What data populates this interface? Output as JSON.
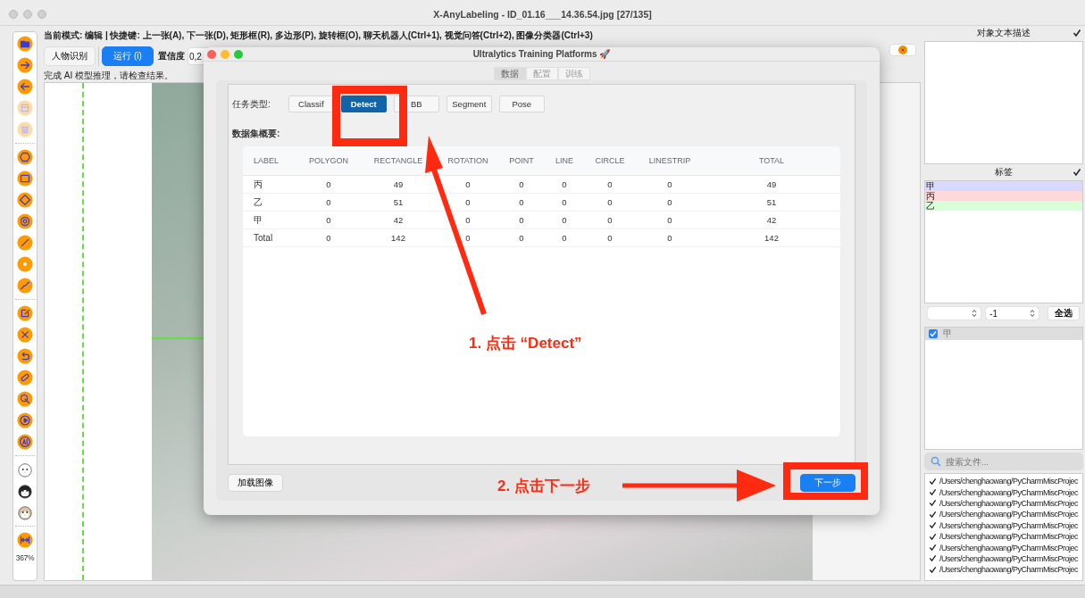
{
  "window": {
    "title": "X-AnyLabeling - ID_01.16___14.36.54.jpg [27/135]"
  },
  "tools": [
    {
      "kind": "folder",
      "disabled": false
    },
    {
      "kind": "next",
      "disabled": false
    },
    {
      "kind": "prev",
      "disabled": false
    },
    {
      "kind": "save",
      "disabled": true
    },
    {
      "kind": "trash",
      "disabled": true
    },
    {
      "kind": "separator"
    },
    {
      "kind": "hexagon",
      "disabled": false
    },
    {
      "kind": "rectangle",
      "disabled": false
    },
    {
      "kind": "diamond",
      "disabled": false
    },
    {
      "kind": "circle",
      "disabled": false
    },
    {
      "kind": "line",
      "disabled": false
    },
    {
      "kind": "point",
      "disabled": false
    },
    {
      "kind": "linestrip",
      "disabled": false
    },
    {
      "kind": "separator"
    },
    {
      "kind": "edit",
      "disabled": false
    },
    {
      "kind": "close",
      "disabled": false
    },
    {
      "kind": "undo",
      "disabled": false
    },
    {
      "kind": "link",
      "disabled": false
    },
    {
      "kind": "cursor",
      "disabled": false
    },
    {
      "kind": "play",
      "disabled": false
    },
    {
      "kind": "ai",
      "disabled": false
    },
    {
      "kind": "separator"
    },
    {
      "kind": "chick",
      "disabled": false
    },
    {
      "kind": "dog",
      "disabled": false
    },
    {
      "kind": "cat",
      "disabled": false
    },
    {
      "kind": "separator"
    },
    {
      "kind": "fit",
      "disabled": false
    }
  ],
  "zoom_level": "367%",
  "mode_line": "当前模式:  编辑 | 快捷键:  上一张(A), 下一张(D), 矩形框(R), 多边形(P), 旋转框(O), 聊天机器人(Ctrl+1), 视觉问答(Ctrl+2), 图像分类器(Ctrl+3)",
  "toolbar": {
    "model_button": "人物识别",
    "run_button": "运行 (i)",
    "confidence_label": "置信度",
    "confidence_value": "0,2"
  },
  "status": "完成 AI 模型推理，请检查结果。",
  "right_panel": {
    "description_title": "对象文本描述",
    "description_checked": true,
    "labels_title": "标签",
    "labels_checked": true,
    "labels": [
      {
        "text": "甲",
        "color": "#d9d9ff"
      },
      {
        "text": "丙",
        "color": "#ffd9d9"
      },
      {
        "text": "乙",
        "color": "#d9ffd9"
      }
    ],
    "group_value": "-1",
    "select_all": "全选",
    "shapes": [
      {
        "text": "甲",
        "checked": true
      }
    ],
    "search_placeholder": "搜索文件...",
    "files": [
      {
        "path": "/Users/chenghaowang/PyCharmMiscProjec",
        "checked": true
      },
      {
        "path": "/Users/chenghaowang/PyCharmMiscProjec",
        "checked": true
      },
      {
        "path": "/Users/chenghaowang/PyCharmMiscProjec",
        "checked": true
      },
      {
        "path": "/Users/chenghaowang/PyCharmMiscProjec",
        "checked": true
      },
      {
        "path": "/Users/chenghaowang/PyCharmMiscProjec",
        "checked": true
      },
      {
        "path": "/Users/chenghaowang/PyCharmMiscProjec",
        "checked": true
      },
      {
        "path": "/Users/chenghaowang/PyCharmMiscProjec",
        "checked": true
      },
      {
        "path": "/Users/chenghaowang/PyCharmMiscProjec",
        "checked": true
      },
      {
        "path": "/Users/chenghaowang/PyCharmMiscProjec",
        "checked": true
      }
    ]
  },
  "dialog": {
    "title": "Ultralytics Training Platforms 🚀",
    "tabs": [
      {
        "label": "数据",
        "selected": true
      },
      {
        "label": "配置",
        "selected": false
      },
      {
        "label": "训练",
        "selected": false
      }
    ],
    "task_label": "任务类型:",
    "tasks": [
      {
        "label": "Classif",
        "selected": false
      },
      {
        "label": "Detect",
        "selected": true
      },
      {
        "label": "BB",
        "selected": false
      },
      {
        "label": "Segment",
        "selected": false
      },
      {
        "label": "Pose",
        "selected": false
      }
    ],
    "summary_label": "数据集概要:",
    "table": {
      "columns": [
        "LABEL",
        "POLYGON",
        "RECTANGLE",
        "ROTATION",
        "POINT",
        "LINE",
        "CIRCLE",
        "LINESTRIP",
        "TOTAL"
      ],
      "rows": [
        [
          "丙",
          "0",
          "49",
          "0",
          "0",
          "0",
          "0",
          "0",
          "49"
        ],
        [
          "乙",
          "0",
          "51",
          "0",
          "0",
          "0",
          "0",
          "0",
          "51"
        ],
        [
          "甲",
          "0",
          "42",
          "0",
          "0",
          "0",
          "0",
          "0",
          "42"
        ],
        [
          "Total",
          "0",
          "142",
          "0",
          "0",
          "0",
          "0",
          "0",
          "142"
        ]
      ]
    },
    "load_button": "加载图像",
    "next_button": "下一步"
  },
  "annotations": [
    {
      "text": "1. 点击 “Detect”"
    },
    {
      "text": "2. 点击下一步"
    }
  ]
}
